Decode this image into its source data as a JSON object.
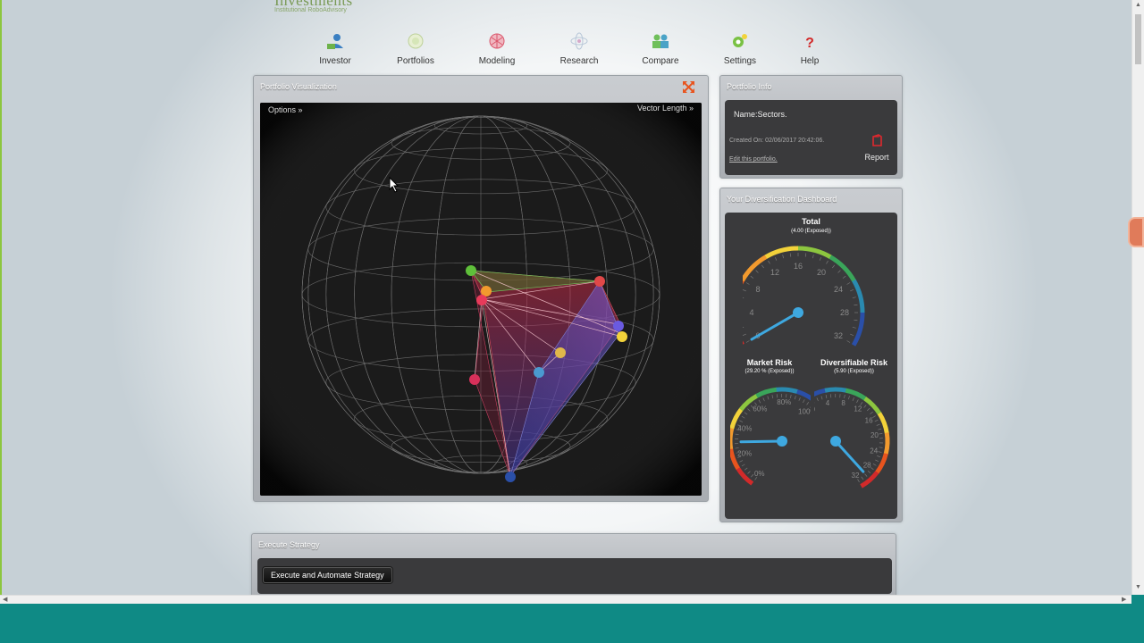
{
  "logo": {
    "title": "Investments",
    "subtitle": "Institutional RoboAdvisory"
  },
  "nav": [
    {
      "label": "Investor",
      "icon": "investor-icon"
    },
    {
      "label": "Portfolios",
      "icon": "portfolios-icon"
    },
    {
      "label": "Modeling",
      "icon": "modeling-icon"
    },
    {
      "label": "Research",
      "icon": "research-icon"
    },
    {
      "label": "Compare",
      "icon": "compare-icon"
    },
    {
      "label": "Settings",
      "icon": "settings-icon"
    },
    {
      "label": "Help",
      "icon": "help-icon"
    }
  ],
  "viz": {
    "title": "Portfolio Visualization",
    "options_label": "Options »",
    "vector_length_label": "Vector Length »"
  },
  "info": {
    "title": "Portfolio Info",
    "name": "Name:Sectors.",
    "created": "Created On: 02/06/2017 20:42:06.",
    "edit": "Edit this portfolio.",
    "report": "Report"
  },
  "dashboard": {
    "title": "Your Diversification Dashboard",
    "total": {
      "title": "Total",
      "sub": "(4.00 (Exposed))",
      "ticks": [
        "0",
        "4",
        "8",
        "12",
        "16",
        "20",
        "24",
        "28",
        "32"
      ],
      "value": 4.0
    },
    "market": {
      "title": "Market Risk",
      "sub": "(29.20 % (Exposed))",
      "ticks": [
        "0%",
        "20%",
        "40%",
        "60%",
        "80%",
        "100%"
      ],
      "value": 29.2
    },
    "divers": {
      "title": "Diversifiable Risk",
      "sub": "(5.90 (Exposed))",
      "ticks": [
        "0",
        "4",
        "8",
        "12",
        "16",
        "20",
        "24",
        "28",
        "32"
      ],
      "value": 5.9
    }
  },
  "execute": {
    "title": "Execute Strategy",
    "button": "Execute and Automate Strategy"
  },
  "colors": {
    "accent_green": "#8cc63f",
    "teal": "#0f8a85",
    "panel_dark": "#3a3a3c",
    "gauge_needle": "#3ea8e0"
  }
}
